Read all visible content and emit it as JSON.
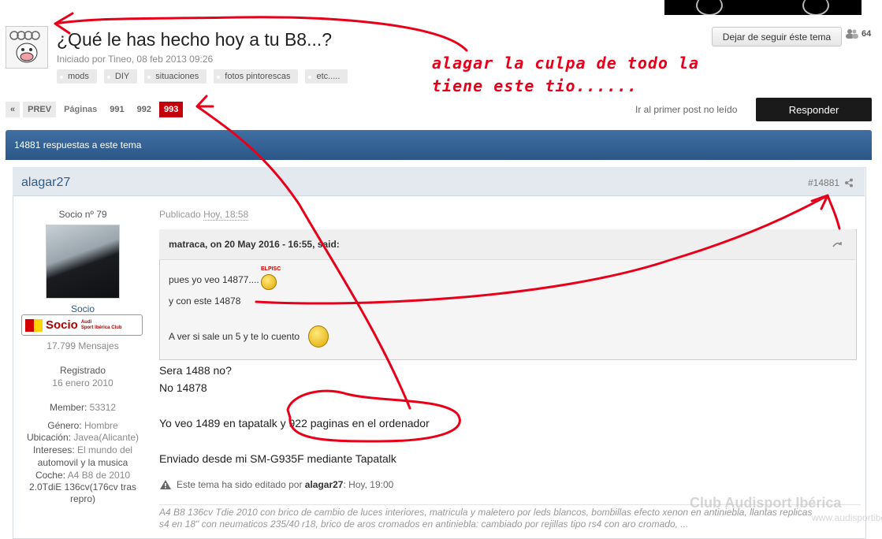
{
  "topic": {
    "title": "¿Qué le has hecho hoy a tu B8...?",
    "started_prefix": "Iniciado por",
    "started_by": "Tineo",
    "started_date": ", 08 feb 2013 09:26",
    "tags": [
      "mods",
      "DIY",
      "situaciones",
      "fotos pintorescas",
      "etc....."
    ],
    "follow_label": "Dejar de seguir éste tema",
    "followers": "64"
  },
  "annotation": {
    "line1": "alagar la culpa de todo la",
    "line2": "tiene este tio......"
  },
  "pager": {
    "first": "«",
    "prev": "PREV",
    "label": "Páginas",
    "pages": [
      "991",
      "992",
      "993"
    ],
    "current": "993",
    "first_unread": "Ir al primer post no leído",
    "reply": "Responder"
  },
  "replies_bar": "14881 respuestas a este tema",
  "post": {
    "author": "alagar27",
    "number": "#14881",
    "member_no": "Socio nº 79",
    "group": "Socio",
    "badge_text": "Socio",
    "badge_sub1": "Audi",
    "badge_sub2": "Sport Ibérica Club",
    "messages": "17.799 Mensajes",
    "registered_label": "Registrado",
    "registered_date": "16 enero 2010",
    "member_label": "Member:",
    "member_value": "53312",
    "gender_label": "Género:",
    "gender_value": "Hombre",
    "location_label": "Ubicación:",
    "location_value": "Javea(Alicante)",
    "interests_label": "Intereses:",
    "interests_value_1": "El mundo del",
    "interests_value_2": "automovil y la musica",
    "car_label": "Coche:",
    "car_value_1": "A4 B8 de 2010",
    "car_value_2": "2.0TdiE 136cv(176cv tras",
    "car_value_3": "repro)",
    "published_prefix": "Publicado",
    "published_time": "Hoy, 18:58",
    "quote_author": "matraca, on 20 May 2016 - 16:55, said:",
    "quote_lines": [
      "pues yo veo 14877....",
      "y con este 14878",
      "A ver si sale un 5 y te lo cuento"
    ],
    "smiley_label": "ELPISC",
    "body_lines": [
      "Sera 1488 no?",
      "No 14878",
      "Yo veo 1489 en tapatalk y 922 paginas en el ordenador",
      "Enviado desde mi SM-G935F mediante Tapatalk"
    ],
    "edited_prefix": "Este tema ha sido editado por",
    "edited_by": "alagar27",
    "edited_time": ": Hoy, 19:00",
    "signature_1": "A4 B8 136cv Tdie 2010 con brico de cambio de luces interiores, matricula y maletero por leds blancos, bombillas efecto xenon en antiniebla, llantas replicas",
    "signature_2": "s4 en 18\" con neumaticos 235/40 r18, brico de aros cromados en antiniebla: cambiado por rejillas tipo rs4 con aro cromado, ..."
  },
  "watermark": {
    "line1": "Club Audisport Ibérica",
    "line2": "www.audisportiberica.com"
  },
  "colors": {
    "annotation": "#e8001a",
    "bluebar": "#2b5687",
    "active_page": "#c4000b",
    "author": "#2e5b8a"
  }
}
